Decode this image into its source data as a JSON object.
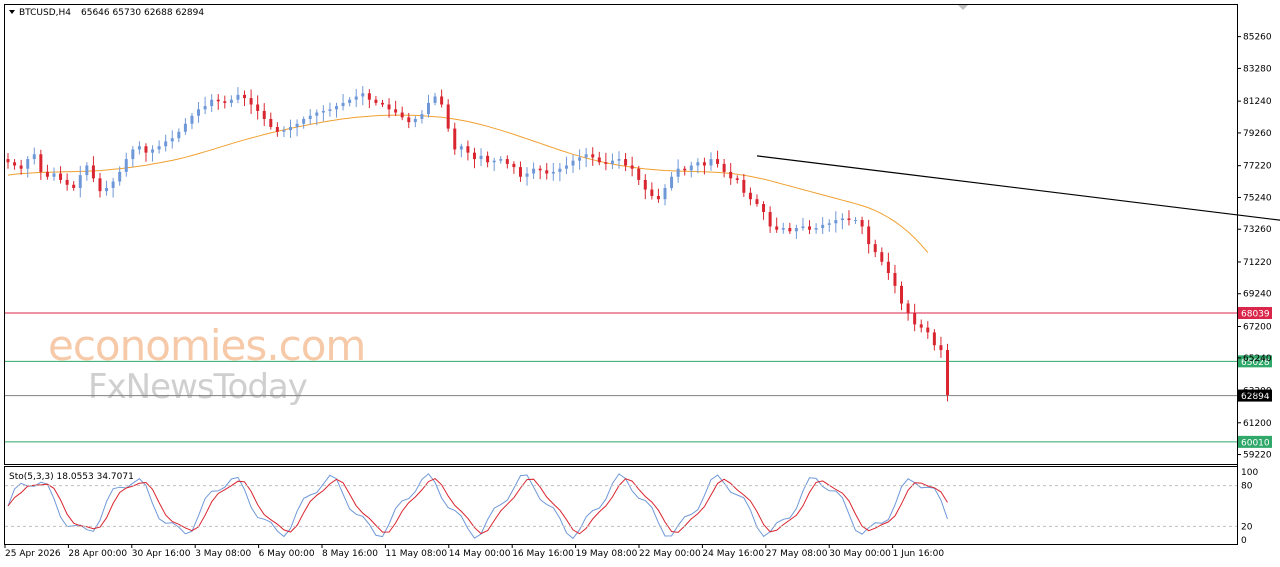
{
  "header": {
    "symbol_label": "BTCUSD,H4",
    "ohlc_label": "65646 65730 62688 62894"
  },
  "indicator": {
    "label": "Sto(5,3,3) 18.0553 34.7071",
    "levels": [
      "100",
      "80",
      "20",
      "0"
    ]
  },
  "watermark": {
    "line1": "economies.com",
    "line2": "FxNewsToday"
  },
  "colors": {
    "bull": "#6f98d8",
    "bear": "#d9252f",
    "ma": "#f0a030",
    "resistance": "#d9254a",
    "support": "#2fa86a",
    "current": "#808080",
    "trendline": "#000000"
  },
  "chart_data": {
    "type": "candlestick",
    "timeframe": "H4",
    "y_ticks": [
      "85260",
      "83280",
      "81240",
      "79260",
      "77220",
      "75240",
      "73260",
      "71220",
      "69240",
      "67200",
      "65240",
      "63200",
      "61200",
      "59220"
    ],
    "y_range": [
      58600,
      87200
    ],
    "x_ticks": [
      "25 Apr 2026",
      "28 Apr 00:00",
      "30 Apr 16:00",
      "3 May 08:00",
      "6 May 00:00",
      "8 May 16:00",
      "11 May 08:00",
      "14 May 00:00",
      "16 May 16:00",
      "19 May 08:00",
      "22 May 00:00",
      "24 May 16:00",
      "27 May 08:00",
      "30 May 00:00",
      "1 Jun 16:00"
    ],
    "horizontal_levels": [
      {
        "label": "68039",
        "value": 68039,
        "kind": "resistance"
      },
      {
        "label": "65028",
        "value": 65028,
        "kind": "support"
      },
      {
        "label": "62894",
        "value": 62894,
        "kind": "current"
      },
      {
        "label": "60010",
        "value": 60010,
        "kind": "support"
      }
    ],
    "trendline": {
      "start": [
        0,
        77800
      ],
      "end": [
        155,
        70000
      ]
    },
    "close": [
      77400,
      77200,
      77000,
      77600,
      77900,
      76800,
      76500,
      76700,
      76300,
      76000,
      75800,
      76600,
      77200,
      76400,
      75600,
      75800,
      76200,
      76800,
      77600,
      78200,
      78400,
      78000,
      78200,
      78400,
      78700,
      78900,
      79300,
      79800,
      80300,
      80700,
      80900,
      81300,
      81200,
      81100,
      81300,
      81600,
      81400,
      81000,
      80600,
      80100,
      79600,
      79300,
      79400,
      79600,
      79800,
      80100,
      80300,
      80500,
      80600,
      80700,
      80900,
      81100,
      81300,
      81500,
      81700,
      81300,
      81100,
      81000,
      80700,
      80500,
      80200,
      79900,
      80100,
      80400,
      81100,
      81500,
      81000,
      79500,
      78200,
      78400,
      78000,
      77600,
      77800,
      77400,
      77500,
      77600,
      77300,
      77100,
      76500,
      76700,
      77000,
      76900,
      76700,
      76800,
      77000,
      77200,
      77500,
      77700,
      77900,
      77700,
      77400,
      77300,
      77500,
      77600,
      77200,
      77000,
      76300,
      75700,
      75300,
      75100,
      75800,
      76500,
      77000,
      76900,
      77200,
      77400,
      77200,
      77600,
      77300,
      76800,
      76400,
      76300,
      75500,
      75100,
      74800,
      74300,
      73400,
      73200,
      73300,
      73100,
      73300,
      73400,
      73200,
      73300,
      73500,
      73600,
      73800,
      73900,
      73800,
      73800,
      73400,
      72300,
      71800,
      71200,
      70500,
      69700,
      68600,
      68000,
      67300,
      67100,
      66800,
      66000,
      65700,
      62894
    ],
    "ma": [
      76600,
      76650,
      76700,
      76720,
      76750,
      76770,
      76780,
      76790,
      76800,
      76810,
      76820,
      76830,
      76840,
      76860,
      76880,
      76920,
      76960,
      77000,
      77050,
      77100,
      77160,
      77220,
      77290,
      77360,
      77440,
      77520,
      77610,
      77710,
      77820,
      77940,
      78060,
      78180,
      78310,
      78430,
      78560,
      78680,
      78800,
      78910,
      79020,
      79130,
      79230,
      79330,
      79420,
      79510,
      79600,
      79680,
      79760,
      79840,
      79910,
      79980,
      80040,
      80100,
      80150,
      80200,
      80240,
      80270,
      80300,
      80320,
      80330,
      80340,
      80340,
      80330,
      80320,
      80300,
      80270,
      80240,
      80200,
      80150,
      80090,
      80020,
      79940,
      79850,
      79750,
      79640,
      79520,
      79400,
      79270,
      79140,
      79000,
      78860,
      78720,
      78580,
      78440,
      78300,
      78160,
      78030,
      77900,
      77780,
      77660,
      77560,
      77460,
      77370,
      77290,
      77220,
      77150,
      77090,
      77040,
      76990,
      76950,
      76920,
      76890,
      76870,
      76850,
      76840,
      76830,
      76820,
      76810,
      76790,
      76770,
      76740,
      76700,
      76650,
      76590,
      76520,
      76440,
      76350,
      76250,
      76140,
      76030,
      75920,
      75810,
      75700,
      75590,
      75480,
      75370,
      75260,
      75150,
      75040,
      74930,
      74820,
      74700,
      74560,
      74390,
      74190,
      73960,
      73700,
      73400,
      73060,
      72680,
      72250,
      71780
    ]
  }
}
